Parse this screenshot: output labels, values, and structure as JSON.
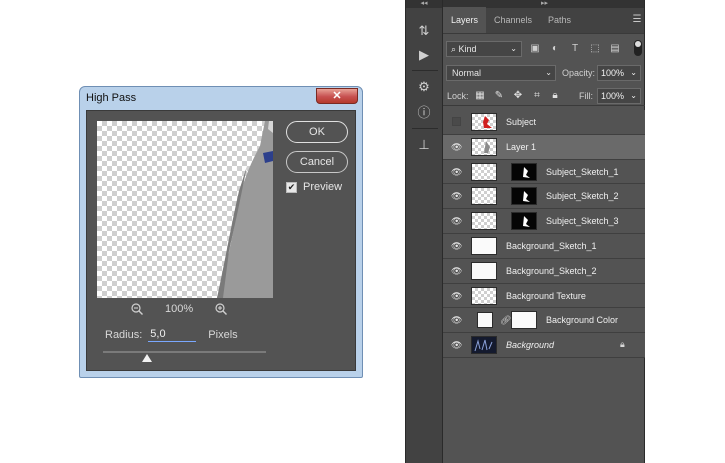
{
  "dialog": {
    "title": "High Pass",
    "close_label": "✕",
    "ok_label": "OK",
    "cancel_label": "Cancel",
    "preview_label": "Preview",
    "preview_checked": true,
    "zoom_level": "100%",
    "radius_label": "Radius:",
    "radius_value": "5,0",
    "radius_unit": "Pixels",
    "radius_slider_fraction": 0.27
  },
  "panel": {
    "tabs": [
      {
        "label": "Layers",
        "active": true
      },
      {
        "label": "Channels",
        "active": false
      },
      {
        "label": "Paths",
        "active": false
      }
    ],
    "filter_kind": "Kind",
    "blend_mode": "Normal",
    "opacity_label": "Opacity:",
    "opacity_value": "100%",
    "lock_label": "Lock:",
    "fill_label": "Fill:",
    "fill_value": "100%",
    "layers": [
      {
        "name": "Subject",
        "visible": false,
        "selected": false
      },
      {
        "name": "Layer 1",
        "visible": true,
        "selected": true
      },
      {
        "name": "Subject_Sketch_1",
        "visible": true,
        "selected": false
      },
      {
        "name": "Subject_Sketch_2",
        "visible": true,
        "selected": false
      },
      {
        "name": "Subject_Sketch_3",
        "visible": true,
        "selected": false
      },
      {
        "name": "Background_Sketch_1",
        "visible": true,
        "selected": false
      },
      {
        "name": "Background_Sketch_2",
        "visible": true,
        "selected": false
      },
      {
        "name": "Background Texture",
        "visible": true,
        "selected": false
      },
      {
        "name": "Background Color",
        "visible": true,
        "selected": false
      },
      {
        "name": "Background",
        "visible": true,
        "selected": false,
        "locked": true
      }
    ]
  },
  "colors": {
    "dialog_frame": "#b9d1ea",
    "dialog_body": "#535353",
    "panel_bg": "#535353",
    "selected_row": "#6a6a6a",
    "close_button": "#c75050"
  }
}
